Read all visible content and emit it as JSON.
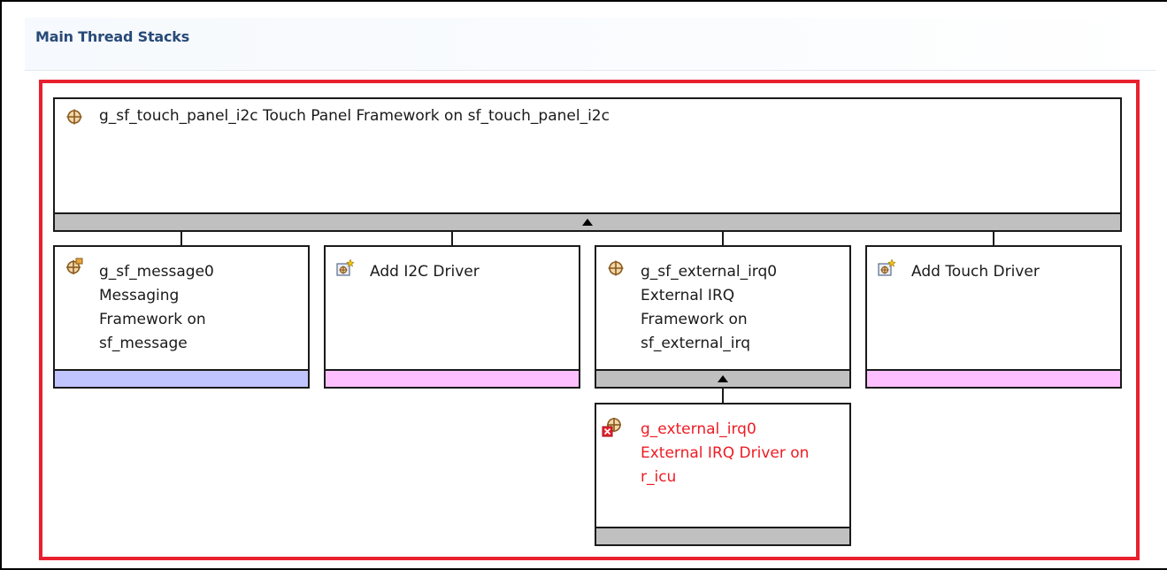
{
  "section": {
    "title": "Main Thread Stacks"
  },
  "top_module": {
    "label": "g_sf_touch_panel_i2c Touch Panel Framework on sf_touch_panel_i2c",
    "icon": "framework-crosshair-icon",
    "bar_color": "#c0c0c0",
    "expandable": true
  },
  "child_modules": [
    {
      "lines": [
        "g_sf_message0",
        "Messaging",
        "Framework on",
        "sf_message"
      ],
      "icon": "framework-crosshair-flag-icon",
      "bar_color": "#c0c4ff"
    },
    {
      "lines": [
        "Add I2C Driver"
      ],
      "icon": "add-driver-icon",
      "bar_color": "#fdbfff"
    },
    {
      "lines": [
        "g_sf_external_irq0",
        "External IRQ",
        "Framework on",
        "sf_external_irq"
      ],
      "icon": "framework-crosshair-icon",
      "bar_color": "#c0c0c0",
      "expandable": true
    },
    {
      "lines": [
        "Add Touch Driver"
      ],
      "icon": "add-driver-icon",
      "bar_color": "#fdbfff"
    }
  ],
  "grandchild_module": {
    "lines": [
      "g_external_irq0",
      "External IRQ Driver on",
      "r_icu"
    ],
    "icon": "driver-error-icon",
    "text_color": "#ee1c24",
    "bar_color": "#c0c0c0"
  },
  "highlight_color": "#e8202e"
}
